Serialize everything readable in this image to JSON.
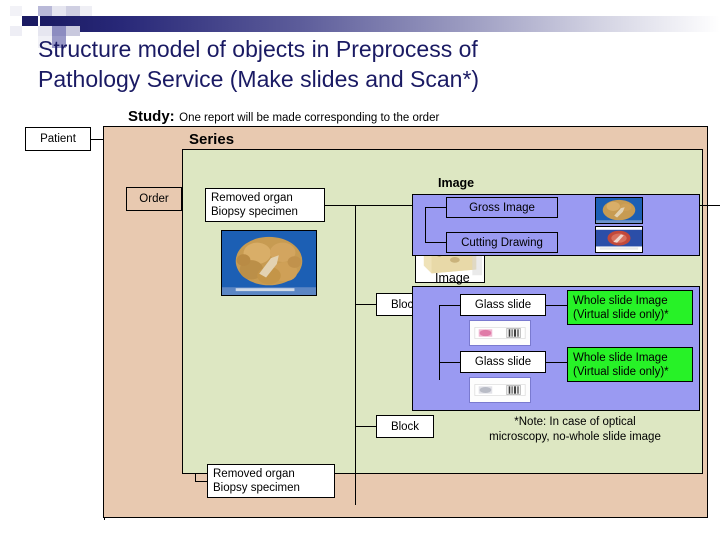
{
  "slide": {
    "title_line1": "Structure model of objects in Preprocess of",
    "title_line2": "Pathology Service (Make slides and Scan*)",
    "title_color": "#1a1a63"
  },
  "study": {
    "label": "Study:",
    "description": "One report will be made corresponding to the order"
  },
  "nodes": {
    "patient": "Patient",
    "order": "Order",
    "series": "Series",
    "specimen_top_line1": "Removed organ",
    "specimen_top_line2": "Biopsy specimen",
    "specimen_bottom_line1": "Removed organ",
    "specimen_bottom_line2": "Biopsy specimen",
    "block_1": "Block",
    "block_2": "Block",
    "glass_slide_1": "Glass slide",
    "glass_slide_2": "Glass slide",
    "gross_image": "Gross Image",
    "cutting_drawing": "Cutting Drawing",
    "wsi_1_line1": "Whole slide Image",
    "wsi_1_line2": "(Virtual slide only)*",
    "wsi_2_line1": "Whole slide Image",
    "wsi_2_line2": "(Virtual slide only)*"
  },
  "image_groups": {
    "image_label_top": "Image",
    "image_label_bottom": "Image"
  },
  "note": {
    "line1": "*Note: In case of  optical",
    "line2": "microscopy, no-whole slide image"
  },
  "colors": {
    "series_bg": "#e8c9b0",
    "study_bg": "#dde7c2",
    "image_bg": "#9a9af2",
    "wsi_bg": "#27f227",
    "title": "#1a1a63",
    "header_gradient_start": "#1b1b63"
  }
}
